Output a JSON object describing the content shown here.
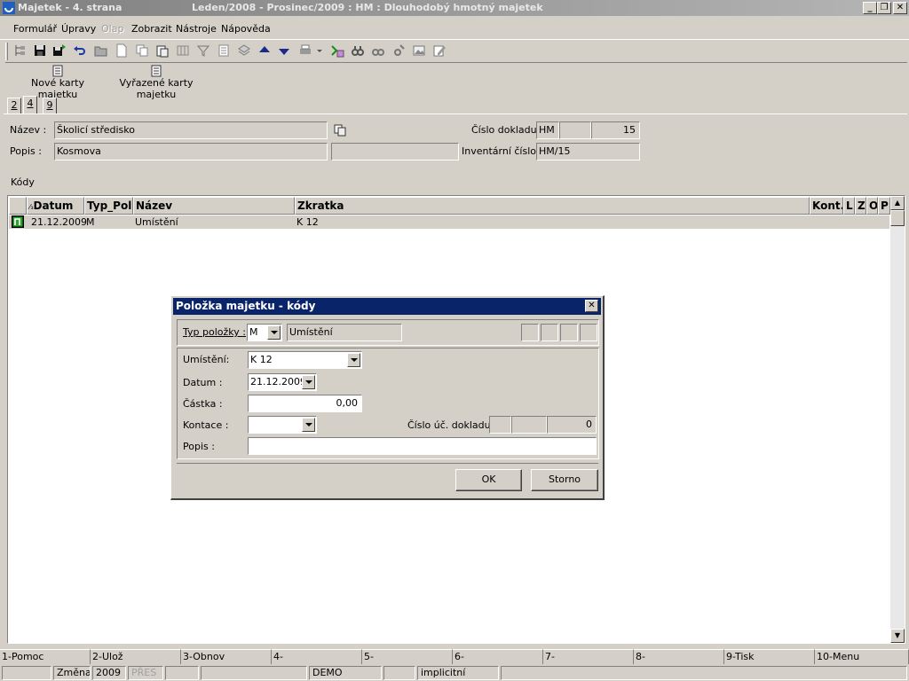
{
  "window": {
    "title": "Majetek - 4. strana",
    "subtitle": "Leden/2008 - Prosinec/2009 : HM : Dlouhodobý hmotný majetek"
  },
  "menu": [
    {
      "label": "Formulář",
      "enabled": true
    },
    {
      "label": "Úpravy",
      "enabled": true
    },
    {
      "label": "Olap",
      "enabled": false
    },
    {
      "label": "Zobrazit",
      "enabled": true
    },
    {
      "label": "Nástroje",
      "enabled": true
    },
    {
      "label": "Nápověda",
      "enabled": true
    }
  ],
  "reports": {
    "new_cards": "Nové karty majetku",
    "discarded_cards": "Vyřazené karty majetku"
  },
  "tabs": [
    "2",
    "4",
    "9"
  ],
  "form": {
    "name_label": "Název :",
    "name_value": "Školicí středisko",
    "desc_label": "Popis :",
    "desc_value": "Kosmova",
    "doc_label": "Číslo dokladu :",
    "doc_type": "HM",
    "doc_mid": "",
    "doc_num": "15",
    "inv_label": "Inventární číslo :",
    "inv_value": "HM/15",
    "extra_value": ""
  },
  "codes_label": "Kódy",
  "grid": {
    "sort_marker": "⁄₃",
    "columns": [
      "Datum",
      "Typ_Pol",
      "Název",
      "Zkratka",
      "Kont.",
      "L",
      "Z",
      "O",
      "P"
    ],
    "rows": [
      {
        "datum": "21.12.2009",
        "typ": "M",
        "nazev": "Umístění",
        "zkratka": "K 12"
      }
    ]
  },
  "dialog": {
    "title": "Položka majetku - kódy",
    "type_label": "Typ položky :",
    "type_value": "M",
    "type_name": "Umístění",
    "location_label": "Umístění:",
    "location_value": "K 12",
    "date_label": "Datum :",
    "date_value": "21.12.2009",
    "amount_label": "Částka :",
    "amount_value": "0,00",
    "contact_label": "Kontace :",
    "contact_value": "",
    "acc_doc_label": "Číslo úč. dokladu :",
    "acc_doc_num": "0",
    "note_label": "Popis :",
    "note_value": "",
    "ok": "OK",
    "cancel": "Storno"
  },
  "fkeys": [
    "1-Pomoc",
    "2-Ulož",
    "3-Obnov",
    "4-",
    "5-",
    "6-",
    "7-",
    "8-",
    "9-Tisk",
    "10-Menu"
  ],
  "status": {
    "mode": "Změna",
    "year": "2009",
    "ins": "PŘES",
    "db": "DEMO",
    "profile": "implicitní"
  },
  "colors": {
    "dialog_title": "#0a246a",
    "face": "#d4d0c8"
  }
}
